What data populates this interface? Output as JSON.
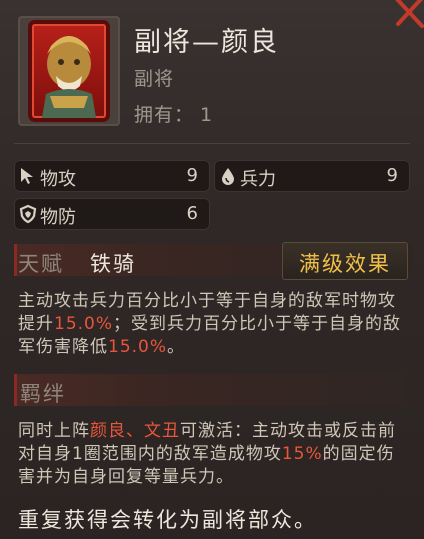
{
  "card": {
    "title": "副将—颜良",
    "subtitle": "副将",
    "owned_label": "拥有：",
    "owned_value": "1"
  },
  "stats": [
    {
      "icon": "sword-cursor-icon",
      "label": "物攻",
      "value": "9"
    },
    {
      "icon": "water-drop-icon",
      "label": "兵力",
      "value": "9"
    },
    {
      "icon": "shield-icon",
      "label": "物防",
      "value": "6"
    }
  ],
  "talent": {
    "header": "天赋",
    "name": "铁骑",
    "max_button": "满级效果",
    "desc": {
      "p1": "主动攻击兵力百分比小于等于自身的敌军时物攻提升",
      "v1": "15.0%",
      "p2": "；受到兵力百分比小于等于自身的敌军伤害降低",
      "v2": "15.0%",
      "p3": "。"
    }
  },
  "bond": {
    "header": "羁绊",
    "desc": {
      "p1": "同时上阵",
      "n1": "颜良",
      "sep": "、",
      "n2": "文丑",
      "p2": "可激活：主动攻击或反击前对自身1圈范围内的敌军造成物攻",
      "v1": "15%",
      "p3": "的固定伤害并为自身回复等量兵力。"
    }
  },
  "footer": "重复获得会转化为副将部众。",
  "colors": {
    "highlight": "#e8563c",
    "gold": "#f0c048",
    "card_red": "#b8201a"
  }
}
